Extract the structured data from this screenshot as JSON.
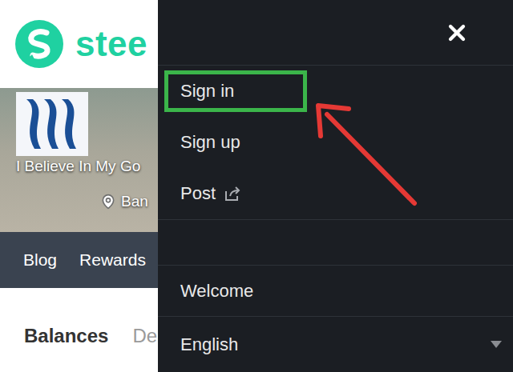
{
  "header": {
    "logo_text": "stee"
  },
  "profile": {
    "name": "I Believe In My Go",
    "location": "Ban"
  },
  "profile_tabs": [
    {
      "label": "Blog",
      "selected": false
    },
    {
      "label": "Rewards",
      "selected": false
    }
  ],
  "wallet_tabs": [
    {
      "label": "Balances",
      "selected": true
    },
    {
      "label": "Del",
      "selected": false
    }
  ],
  "menu": {
    "items": [
      {
        "label": "Sign in",
        "highlighted": true,
        "external": false
      },
      {
        "label": "Sign up",
        "highlighted": false,
        "external": false
      },
      {
        "label": "Post",
        "highlighted": false,
        "external": true
      }
    ],
    "welcome": "Welcome",
    "language": {
      "label": "English",
      "expanded": false
    }
  }
}
